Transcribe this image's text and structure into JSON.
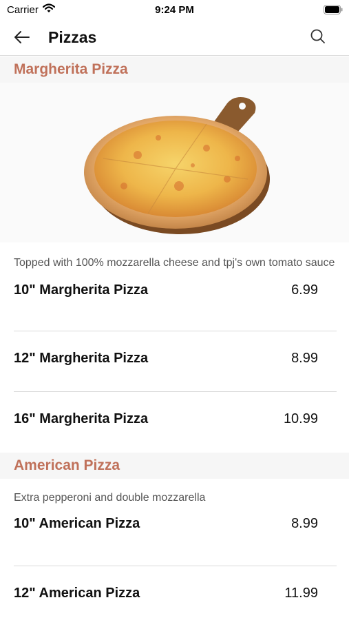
{
  "status_bar": {
    "carrier": "Carrier",
    "time": "9:24 PM"
  },
  "nav": {
    "title": "Pizzas"
  },
  "sections": [
    {
      "title": "Margherita Pizza",
      "description": "Topped with 100% mozzarella cheese and tpj's own tomato sauce",
      "items": [
        {
          "name": "10\" Margherita Pizza",
          "price": "6.99"
        },
        {
          "name": "12\" Margherita Pizza",
          "price": "8.99"
        },
        {
          "name": "16\" Margherita Pizza",
          "price": "10.99"
        }
      ]
    },
    {
      "title": "American Pizza",
      "description": "Extra pepperoni and double mozzarella",
      "items": [
        {
          "name": "10\" American Pizza",
          "price": "8.99"
        },
        {
          "name": "12\" American Pizza",
          "price": "11.99"
        }
      ]
    }
  ],
  "colors": {
    "accent": "#c0715a",
    "divider": "#d9d9d9",
    "section_bg": "#f6f6f6"
  }
}
